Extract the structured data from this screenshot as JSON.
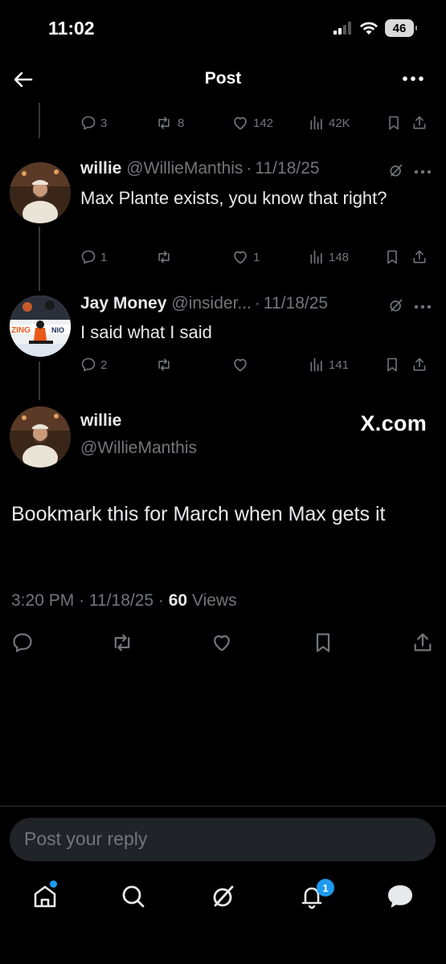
{
  "status": {
    "time": "11:02",
    "battery": "46"
  },
  "header": {
    "title": "Post"
  },
  "top_post_actions": {
    "replies": "3",
    "reposts": "8",
    "likes": "142",
    "views": "42K"
  },
  "replies": [
    {
      "name": "willie",
      "handle": "@WillieManthis",
      "date": "11/18/25",
      "text": "Max Plante exists, you know that right?",
      "actions": {
        "replies": "1",
        "reposts": "",
        "likes": "1",
        "views": "148"
      }
    },
    {
      "name": "Jay Money",
      "handle": "@insider...",
      "date": "11/18/25",
      "text": "I said what I said",
      "actions": {
        "replies": "2",
        "reposts": "",
        "likes": "",
        "views": "141"
      }
    }
  ],
  "main_post": {
    "name": "willie",
    "handle": "@WillieManthis",
    "source_logo": "X.com",
    "text": "Bookmark this for March when Max gets it",
    "time": "3:20 PM",
    "date": "11/18/25",
    "views_count": "60",
    "views_label": "Views"
  },
  "reply_bar": {
    "placeholder": "Post your reply"
  },
  "nav": {
    "notifications_badge": "1"
  },
  "colors": {
    "background": "#000000",
    "text": "#e7e9ea",
    "muted": "#71767b",
    "accent": "#1d9bf0",
    "input_bg": "#202327"
  },
  "icons": [
    "back-arrow-icon",
    "more-icon",
    "reply-icon",
    "repost-icon",
    "like-icon",
    "views-icon",
    "bookmark-icon",
    "share-icon",
    "grok-icon",
    "home-icon",
    "search-icon",
    "notifications-icon",
    "messages-icon"
  ]
}
